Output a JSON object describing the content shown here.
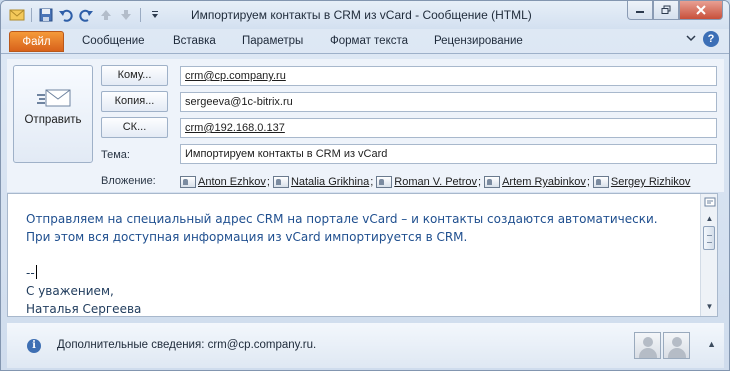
{
  "window": {
    "title": "Импортируем контакты в CRM из vCard  -  Сообщение (HTML)"
  },
  "quick_access": [
    "save-icon",
    "undo-icon",
    "redo-icon",
    "up-arrow-icon",
    "down-arrow-icon",
    "customize-icon"
  ],
  "ribbon": {
    "tabs": [
      "Файл",
      "Сообщение",
      "Вставка",
      "Параметры",
      "Формат текста",
      "Рецензирование"
    ]
  },
  "header": {
    "send_label": "Отправить",
    "to_label": "Кому...",
    "cc_label": "Копия...",
    "bcc_label": "СК...",
    "subject_label": "Тема:",
    "attach_label": "Вложение:",
    "to_value": "crm@cp.company.ru",
    "cc_value": "sergeeva@1c-bitrix.ru",
    "bcc_value": "crm@192.168.0.137",
    "subject_value": "Импортируем контакты в CRM из vCard",
    "attachments": [
      "Anton Ezhkov",
      "Natalia Grikhina",
      "Roman V. Petrov",
      "Artem Ryabinkov",
      "Sergey Rizhikov"
    ],
    "attach_separator": ";"
  },
  "body": {
    "line1": "Отправляем на специальный адрес CRM на портале vCard – и контакты создаются автоматически.",
    "line2": "При этом вся доступная информация из vCard импортируется в CRM.",
    "sig_dash": "--",
    "sig_greeting": "С уважением,",
    "sig_name": "Наталья Сергеева"
  },
  "infobar": {
    "text": "Дополнительные сведения: crm@cp.company.ru."
  },
  "colors": {
    "file_tab": "#e07a2a",
    "body_text": "#1f4f8f",
    "accent": "#3e6fb3"
  }
}
